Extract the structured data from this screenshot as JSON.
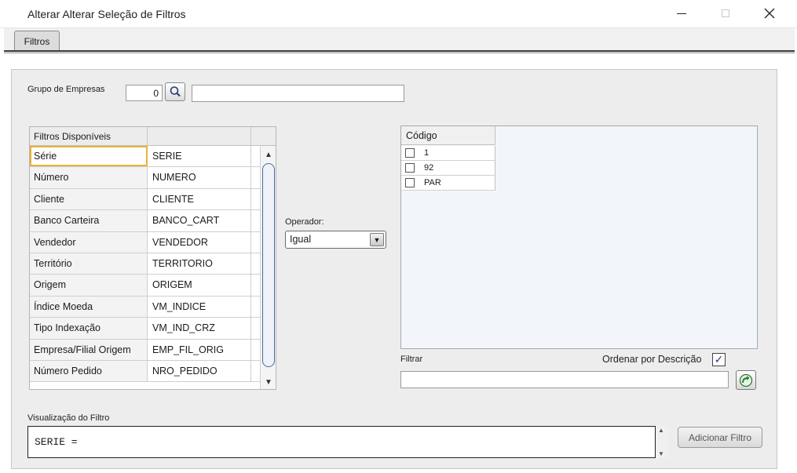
{
  "window": {
    "title": "Alterar Alterar Seleção de Filtros"
  },
  "tabs": [
    {
      "label": "Filtros"
    }
  ],
  "grupo_empresas": {
    "label": "Grupo de Empresas",
    "code": "0",
    "description": ""
  },
  "filters_grid": {
    "headers": [
      "Filtros Disponíveis",
      ""
    ],
    "rows": [
      {
        "name": "Série",
        "field": "SERIE"
      },
      {
        "name": "Número",
        "field": "NUMERO"
      },
      {
        "name": "Cliente",
        "field": "CLIENTE"
      },
      {
        "name": "Banco Carteira",
        "field": "BANCO_CART"
      },
      {
        "name": "Vendedor",
        "field": "VENDEDOR"
      },
      {
        "name": "Território",
        "field": "TERRITORIO"
      },
      {
        "name": "Origem",
        "field": "ORIGEM"
      },
      {
        "name": "Índice Moeda",
        "field": "VM_INDICE"
      },
      {
        "name": "Tipo Indexação",
        "field": "VM_IND_CRZ"
      },
      {
        "name": "Empresa/Filial Origem",
        "field": "EMP_FIL_ORIG"
      },
      {
        "name": "Número Pedido",
        "field": "NRO_PEDIDO"
      }
    ],
    "selected_index": 0
  },
  "operator": {
    "label": "Operador:",
    "value": "Igual"
  },
  "codes": {
    "header": "Código",
    "items": [
      {
        "label": "1",
        "checked": false
      },
      {
        "label": "92",
        "checked": false
      },
      {
        "label": "PAR",
        "checked": false
      }
    ]
  },
  "filtrar": {
    "label": "Filtrar",
    "value": ""
  },
  "ordenar": {
    "label": "Ordenar por Descrição",
    "checked": true
  },
  "visualizacao": {
    "label": "Visualização do Filtro",
    "text": "SERIE ="
  },
  "add_filter": {
    "label": "Adicionar Filtro"
  }
}
